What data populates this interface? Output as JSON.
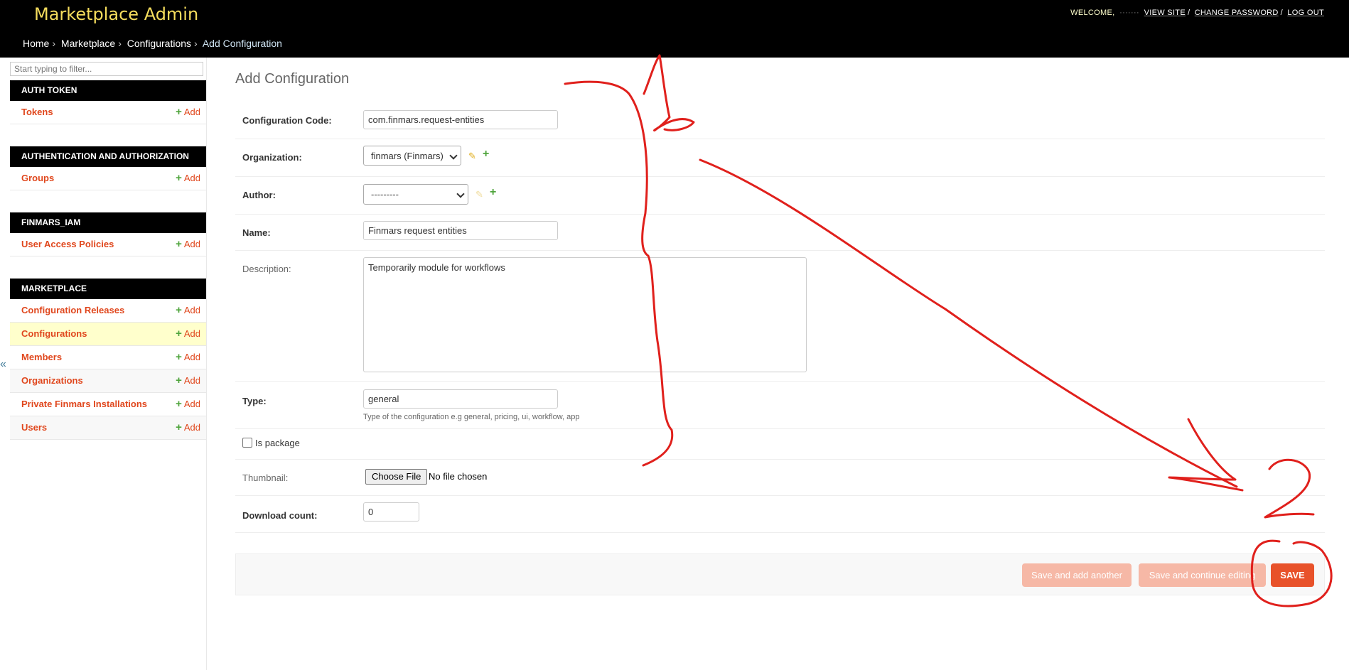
{
  "header": {
    "branding": "Marketplace Admin",
    "welcome": "WELCOME,",
    "username_redacted": "",
    "links": [
      "VIEW SITE",
      "CHANGE PASSWORD",
      "LOG OUT"
    ]
  },
  "breadcrumbs": {
    "items": [
      "Home",
      "Marketplace",
      "Configurations"
    ],
    "current": "Add Configuration"
  },
  "sidebar": {
    "filter_placeholder": "Start typing to filter...",
    "add_label": "Add",
    "modules": [
      {
        "caption": "AUTH TOKEN",
        "models": [
          "Tokens"
        ]
      },
      {
        "caption": "AUTHENTICATION AND AUTHORIZATION",
        "models": [
          "Groups"
        ]
      },
      {
        "caption": "FINMARS_IAM",
        "models": [
          "User Access Policies"
        ]
      },
      {
        "caption": "MARKETPLACE",
        "models": [
          "Configuration Releases",
          "Configurations",
          "Members",
          "Organizations",
          "Private Finmars Installations",
          "Users"
        ]
      }
    ],
    "toggle": "«"
  },
  "content": {
    "title": "Add Configuration",
    "fields": {
      "configuration_code": {
        "label": "Configuration Code:",
        "value": "com.finmars.request-entities"
      },
      "organization": {
        "label": "Organization:",
        "value": "finmars (Finmars)"
      },
      "author": {
        "label": "Author:",
        "value": "---------"
      },
      "name": {
        "label": "Name:",
        "value": "Finmars request entities"
      },
      "description": {
        "label": "Description:",
        "value": "Temporarily module for workflows"
      },
      "type": {
        "label": "Type:",
        "value": "general",
        "help": "Type of the configuration e.g general, pricing, ui, workflow, app"
      },
      "is_package": {
        "label": "Is package"
      },
      "thumbnail": {
        "label": "Thumbnail:",
        "button": "Choose File",
        "status": "No file chosen"
      },
      "download_count": {
        "label": "Download count:",
        "value": "0"
      }
    },
    "submit": {
      "save_add_another": "Save and add another",
      "save_continue": "Save and continue editing",
      "save": "SAVE"
    }
  },
  "annotations": {
    "label_1": "1",
    "label_2": "2",
    "color": "#e0201c"
  }
}
